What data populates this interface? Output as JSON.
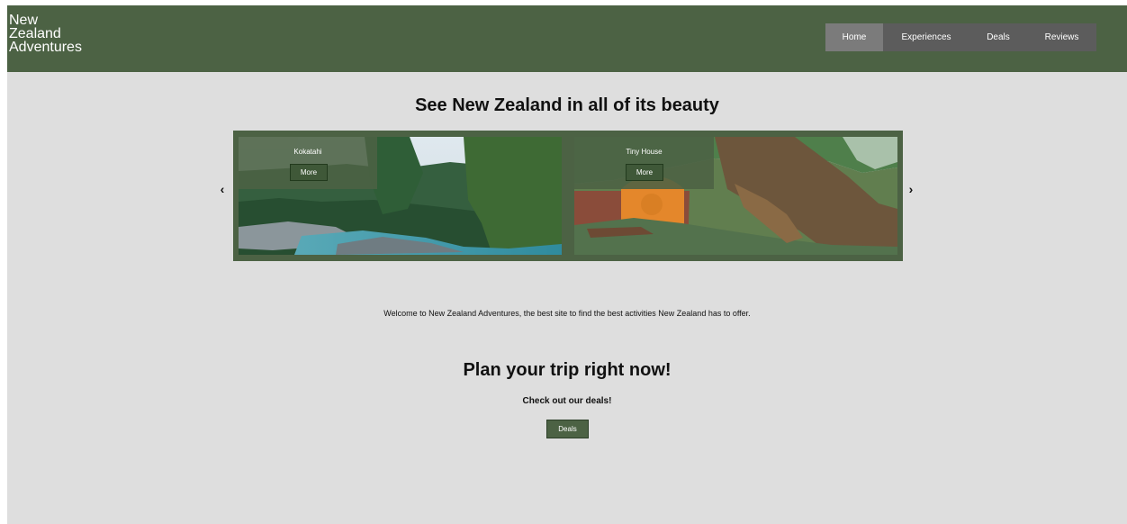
{
  "header": {
    "logo": "New\nZealand\nAdventures",
    "nav": [
      {
        "label": "Home",
        "active": true
      },
      {
        "label": "Experiences",
        "active": false
      },
      {
        "label": "Deals",
        "active": false
      },
      {
        "label": "Reviews",
        "active": false
      }
    ]
  },
  "hero": {
    "title": "See New Zealand in all of its beauty",
    "slides": [
      {
        "title": "Kokatahi",
        "button": "More"
      },
      {
        "title": "Tiny House",
        "button": "More"
      }
    ],
    "prev_label": "‹",
    "next_label": "›"
  },
  "welcome_text": "Welcome to New Zealand Adventures, the best site to find the best activities New Zealand has to offer.",
  "cta": {
    "title": "Plan your trip right now!",
    "subtitle": "Check out our deals!",
    "button": "Deals"
  },
  "colors": {
    "header_bg": "#4c6244",
    "page_bg": "#dedede",
    "nav_bg": "#5c5c5c",
    "nav_active": "#7b7b7b"
  }
}
